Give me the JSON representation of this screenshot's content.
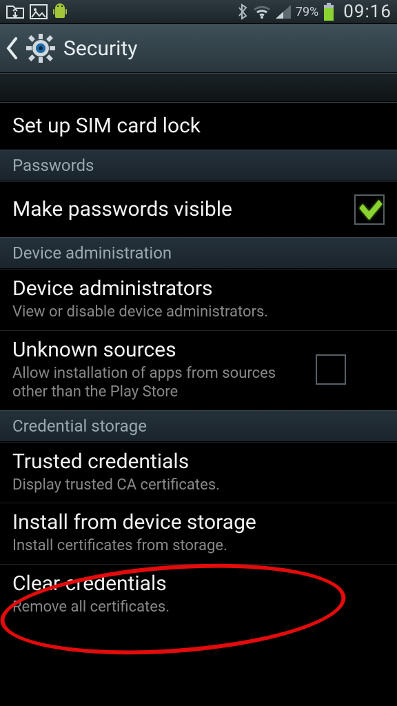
{
  "status": {
    "battery_pct": "79%",
    "time": "09:16"
  },
  "header": {
    "title": "Security"
  },
  "items": {
    "sim_lock": {
      "title": "Set up SIM card lock"
    },
    "sec_passwords": {
      "label": "Passwords"
    },
    "pw_visible": {
      "title": "Make passwords visible",
      "checked": true
    },
    "sec_device_admin": {
      "label": "Device administration"
    },
    "device_admins": {
      "title": "Device administrators",
      "sub": "View or disable device administrators."
    },
    "unknown_sources": {
      "title": "Unknown sources",
      "sub": "Allow installation of apps from sources other than the Play Store",
      "checked": false
    },
    "sec_cred_storage": {
      "label": "Credential storage"
    },
    "trusted_creds": {
      "title": "Trusted credentials",
      "sub": "Display trusted CA certificates."
    },
    "install_storage": {
      "title": "Install from device storage",
      "sub": "Install certificates from storage."
    },
    "clear_creds": {
      "title": "Clear credentials",
      "sub": "Remove all certificates."
    }
  }
}
